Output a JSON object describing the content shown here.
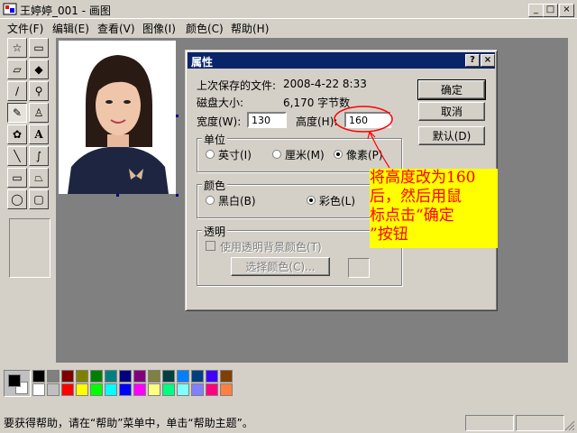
{
  "window": {
    "title": "王婷婷_001 - 画图",
    "min_label": "_",
    "max_label": "□",
    "close_label": "×"
  },
  "menu": [
    "文件(F)",
    "编辑(E)",
    "查看(V)",
    "图像(I)",
    "颜色(C)",
    "帮助(H)"
  ],
  "tools": [
    {
      "name": "free-select",
      "glyph": "☆"
    },
    {
      "name": "rect-select",
      "glyph": "▭"
    },
    {
      "name": "eraser",
      "glyph": "▱"
    },
    {
      "name": "fill",
      "glyph": "◆"
    },
    {
      "name": "color-picker",
      "glyph": "∕"
    },
    {
      "name": "magnifier",
      "glyph": "⚲"
    },
    {
      "name": "pencil",
      "glyph": "✎"
    },
    {
      "name": "brush",
      "glyph": "♙"
    },
    {
      "name": "airbrush",
      "glyph": "✿"
    },
    {
      "name": "text",
      "glyph": "A"
    },
    {
      "name": "line",
      "glyph": "╲"
    },
    {
      "name": "curve",
      "glyph": "∫"
    },
    {
      "name": "rectangle",
      "glyph": "▭"
    },
    {
      "name": "polygon",
      "glyph": "⏢"
    },
    {
      "name": "ellipse",
      "glyph": "◯"
    },
    {
      "name": "rounded-rect",
      "glyph": "▢"
    }
  ],
  "dialog": {
    "title": "属性",
    "help_label": "?",
    "close_label": "×",
    "last_saved_label": "上次保存的文件:",
    "last_saved_value": "2008-4-22 8:33",
    "disk_size_label": "磁盘大小:",
    "disk_size_value": "6,170 字节数",
    "width_label": "宽度(W):",
    "width_value": "130",
    "height_label": "高度(H):",
    "height_value": "160",
    "units_group": "单位",
    "unit_inch": "英寸(I)",
    "unit_cm": "厘米(M)",
    "unit_pixel": "像素(P)",
    "colors_group": "颜色",
    "color_bw": "黑白(B)",
    "color_color": "彩色(L)",
    "transparency_group": "透明",
    "use_transparent": "使用透明背景颜色(T)",
    "choose_color": "选择颜色(C)...",
    "ok": "确定",
    "cancel": "取消",
    "default": "默认(D)"
  },
  "annotation": {
    "line1": "将高度改为160",
    "line2": "后，然后用鼠",
    "line3": "标点击“确定",
    "line4": "”按钮"
  },
  "palette": {
    "foreground": "#000000",
    "background": "#ffffff",
    "colors_top": [
      "#000000",
      "#808080",
      "#800000",
      "#808000",
      "#008000",
      "#008080",
      "#000080",
      "#800080",
      "#808040",
      "#004040",
      "#0080ff",
      "#004080",
      "#4000ff",
      "#804000"
    ],
    "colors_bottom": [
      "#ffffff",
      "#c0c0c0",
      "#ff0000",
      "#ffff00",
      "#00ff00",
      "#00ffff",
      "#0000ff",
      "#ff00ff",
      "#ffff80",
      "#00ff80",
      "#80ffff",
      "#8080ff",
      "#ff0080",
      "#ff8040"
    ]
  },
  "status": {
    "text": "要获得帮助，请在“帮助”菜单中，单击“帮助主题”。"
  }
}
